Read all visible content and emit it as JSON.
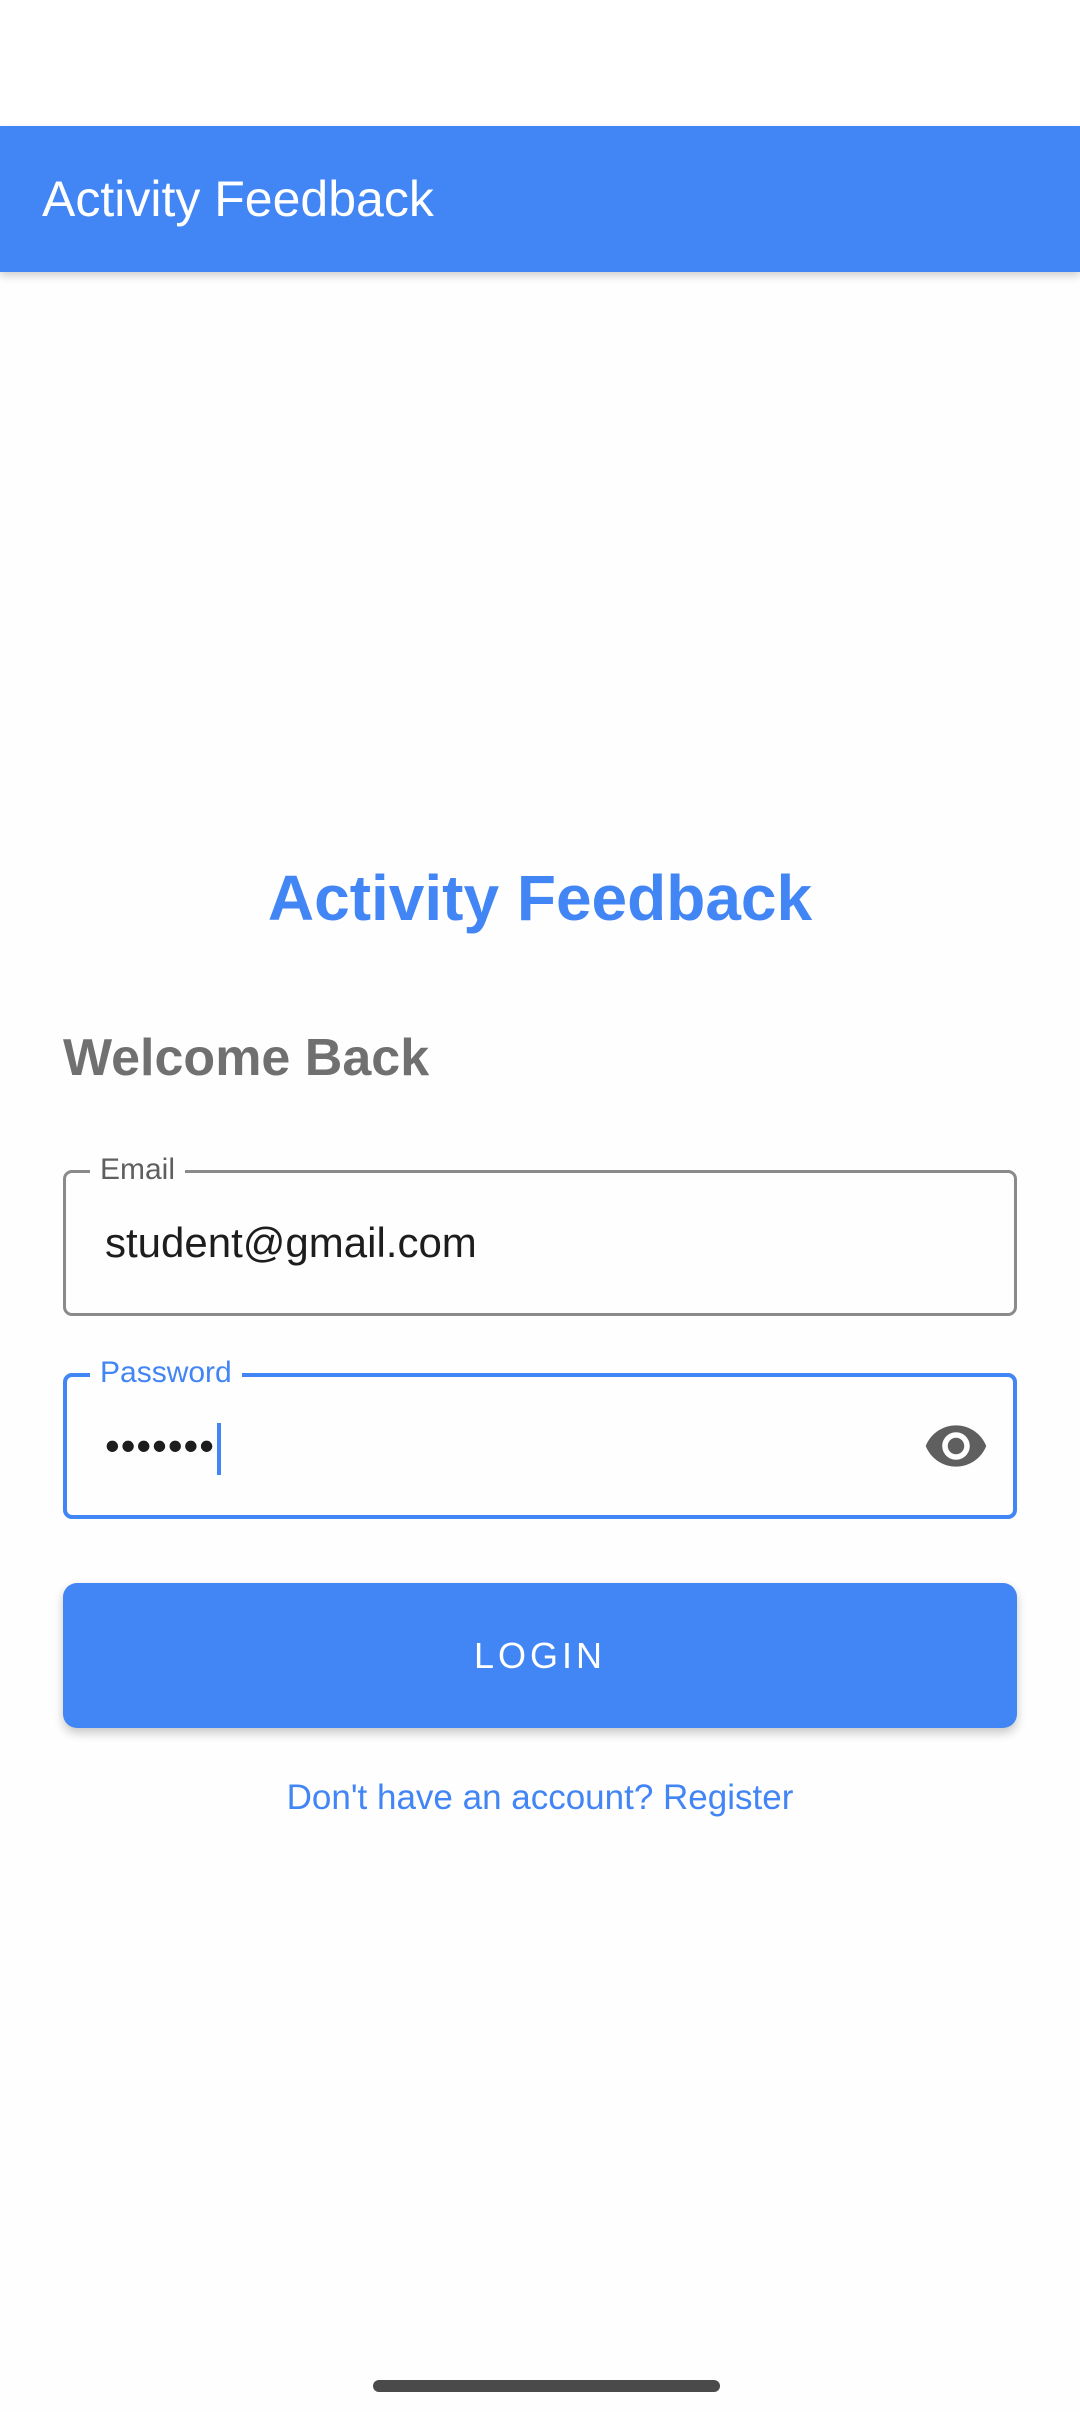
{
  "app_bar": {
    "title": "Activity Feedback"
  },
  "login": {
    "brand_title": "Activity Feedback",
    "welcome": "Welcome Back",
    "email": {
      "label": "Email",
      "value": "student@gmail.com"
    },
    "password": {
      "label": "Password",
      "masked_value": "•••••••",
      "visibility_icon": "eye-icon"
    },
    "login_button": "LOGIN",
    "register_link": "Don't have an account? Register"
  },
  "colors": {
    "primary": "#4285f4",
    "welcome_text": "#707070",
    "field_border": "#8a8a8a"
  }
}
